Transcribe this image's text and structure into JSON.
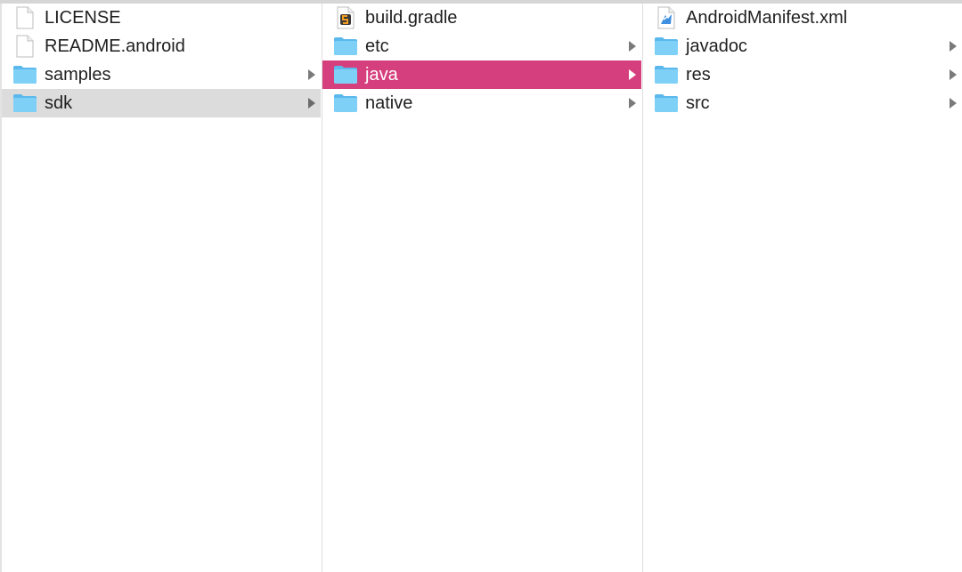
{
  "columns": [
    {
      "items": [
        {
          "label": "LICENSE",
          "icon": "document-icon"
        },
        {
          "label": "README.android",
          "icon": "document-icon"
        },
        {
          "label": "samples",
          "icon": "folder-icon"
        },
        {
          "label": "sdk",
          "icon": "folder-icon"
        }
      ]
    },
    {
      "items": [
        {
          "label": "build.gradle",
          "icon": "gradle-file-icon"
        },
        {
          "label": "etc",
          "icon": "folder-icon"
        },
        {
          "label": "java",
          "icon": "folder-icon"
        },
        {
          "label": "native",
          "icon": "folder-icon"
        }
      ]
    },
    {
      "items": [
        {
          "label": "AndroidManifest.xml",
          "icon": "xml-file-icon"
        },
        {
          "label": "javadoc",
          "icon": "folder-icon"
        },
        {
          "label": "res",
          "icon": "folder-icon"
        },
        {
          "label": "src",
          "icon": "folder-icon"
        }
      ]
    }
  ],
  "colors": {
    "selection_active": "#d63f7e",
    "selection_inactive": "#dcdcdc",
    "folder": "#6cc6f5",
    "chevron": "#7a7a7a"
  }
}
